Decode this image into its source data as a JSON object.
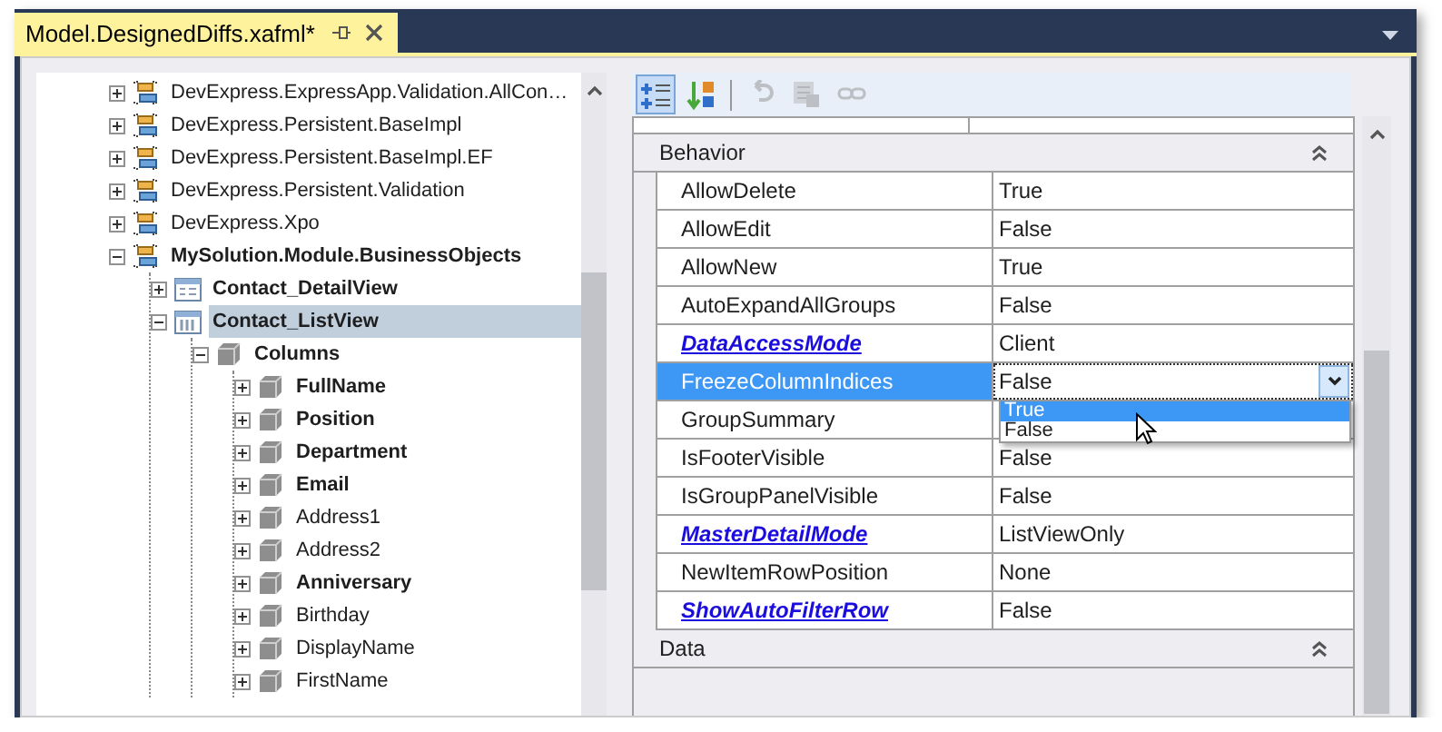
{
  "document_tab": {
    "title": "Model.DesignedDiffs.xafml*",
    "selected": true
  },
  "tree": {
    "nodes": [
      {
        "label": "DevExpress.ExpressApp.Validation.AllCon…",
        "kind": "assembly",
        "bold": false,
        "expanded": false,
        "selected": false
      },
      {
        "label": "DevExpress.Persistent.BaseImpl",
        "kind": "assembly",
        "bold": false,
        "expanded": false,
        "selected": false
      },
      {
        "label": "DevExpress.Persistent.BaseImpl.EF",
        "kind": "assembly",
        "bold": false,
        "expanded": false,
        "selected": false
      },
      {
        "label": "DevExpress.Persistent.Validation",
        "kind": "assembly",
        "bold": false,
        "expanded": false,
        "selected": false
      },
      {
        "label": "DevExpress.Xpo",
        "kind": "assembly",
        "bold": false,
        "expanded": false,
        "selected": false
      },
      {
        "label": "MySolution.Module.BusinessObjects",
        "kind": "assembly",
        "bold": true,
        "expanded": true,
        "selected": false,
        "children": [
          {
            "label": "Contact_DetailView",
            "kind": "detail-view",
            "bold": true,
            "expanded": false,
            "selected": false
          },
          {
            "label": "Contact_ListView",
            "kind": "list-view",
            "bold": true,
            "expanded": true,
            "selected": true,
            "children": [
              {
                "label": "Columns",
                "kind": "node",
                "bold": true,
                "expanded": true,
                "selected": false,
                "children": [
                  {
                    "label": "FullName",
                    "kind": "node",
                    "bold": true,
                    "expanded": false,
                    "selected": false
                  },
                  {
                    "label": "Position",
                    "kind": "node",
                    "bold": true,
                    "expanded": false,
                    "selected": false
                  },
                  {
                    "label": "Department",
                    "kind": "node",
                    "bold": true,
                    "expanded": false,
                    "selected": false
                  },
                  {
                    "label": "Email",
                    "kind": "node",
                    "bold": true,
                    "expanded": false,
                    "selected": false
                  },
                  {
                    "label": "Address1",
                    "kind": "node",
                    "bold": false,
                    "expanded": false,
                    "selected": false
                  },
                  {
                    "label": "Address2",
                    "kind": "node",
                    "bold": false,
                    "expanded": false,
                    "selected": false
                  },
                  {
                    "label": "Anniversary",
                    "kind": "node",
                    "bold": true,
                    "expanded": false,
                    "selected": false
                  },
                  {
                    "label": "Birthday",
                    "kind": "node",
                    "bold": false,
                    "expanded": false,
                    "selected": false
                  },
                  {
                    "label": "DisplayName",
                    "kind": "node",
                    "bold": false,
                    "expanded": false,
                    "selected": false
                  },
                  {
                    "label": "FirstName",
                    "kind": "node",
                    "bold": false,
                    "expanded": false,
                    "selected": false
                  }
                ]
              }
            ]
          }
        ]
      }
    ]
  },
  "toolbar": [
    {
      "kind": "categorized",
      "selected": true,
      "disabled": false
    },
    {
      "kind": "alphabetical",
      "selected": false,
      "disabled": false
    },
    {
      "kind": "reset",
      "selected": false,
      "disabled": true
    },
    {
      "kind": "localization",
      "selected": false,
      "disabled": true
    },
    {
      "kind": "link",
      "selected": false,
      "disabled": true
    }
  ],
  "properties": {
    "categories": [
      {
        "name": "Behavior",
        "expanded": true,
        "rows": [
          {
            "name": "AllowDelete",
            "value": "True",
            "modified": false,
            "selected": false
          },
          {
            "name": "AllowEdit",
            "value": "False",
            "modified": false,
            "selected": false
          },
          {
            "name": "AllowNew",
            "value": "True",
            "modified": false,
            "selected": false
          },
          {
            "name": "AutoExpandAllGroups",
            "value": "False",
            "modified": false,
            "selected": false
          },
          {
            "name": "DataAccessMode",
            "value": "Client",
            "modified": true,
            "selected": false
          },
          {
            "name": "FreezeColumnIndices",
            "value": "False",
            "modified": false,
            "selected": true,
            "dropdown": {
              "options": [
                {
                  "label": "True",
                  "selected": true
                },
                {
                  "label": "False",
                  "selected": false
                }
              ]
            }
          },
          {
            "name": "GroupSummary",
            "modified": false,
            "selected": false
          },
          {
            "name": "IsFooterVisible",
            "value": "False",
            "modified": false,
            "selected": false
          },
          {
            "name": "IsGroupPanelVisible",
            "value": "False",
            "modified": false,
            "selected": false
          },
          {
            "name": "MasterDetailMode",
            "value": "ListViewOnly",
            "modified": true,
            "selected": false
          },
          {
            "name": "NewItemRowPosition",
            "value": "None",
            "modified": false,
            "selected": false
          },
          {
            "name": "ShowAutoFilterRow",
            "value": "False",
            "modified": true,
            "selected": false
          }
        ]
      },
      {
        "name": "Data",
        "expanded": true
      }
    ]
  }
}
